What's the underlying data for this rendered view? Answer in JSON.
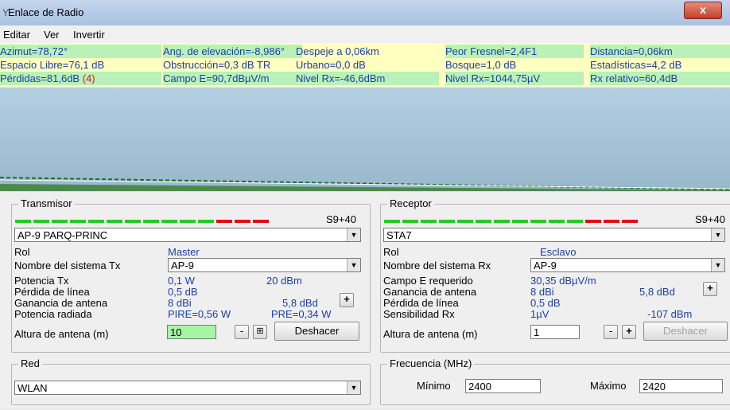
{
  "window": {
    "title": "Enlace de Radio",
    "close_label": "x"
  },
  "menu": [
    "Editar",
    "Ver",
    "Invertir"
  ],
  "info": {
    "row1": [
      "Azimut=78,72°",
      "Ang. de elevación=-8,986°",
      "Despeje a 0,06km",
      "Peor Fresnel=2,4F1",
      "Distancia=0,06km"
    ],
    "row2": [
      "Espacio Libre=76,1 dB",
      "Obstrucción=0,3 dB TR",
      "Urbano=0,0 dB",
      "Bosque=1,0 dB",
      "Estadísticas=4,2 dB"
    ],
    "row3_losses": "Pérdidas=81,6dB",
    "row3_losses_count": "(4)",
    "row3": [
      "Campo E=90,7dBµV/m",
      "Nivel Rx=-46,6dBm",
      "Nivel Rx=1044,75µV",
      "Rx relativo=60,4dB"
    ]
  },
  "transmitter": {
    "legend": "Transmisor",
    "s_meter": "S9+40",
    "site": "AP-9 PARQ-PRINC",
    "role_label": "Rol",
    "role_value": "Master",
    "system_label": "Nombre del sistema Tx",
    "system_value": "AP-9",
    "power_label": "Potencia Tx",
    "power_w": "0,1 W",
    "power_dbm": "20 dBm",
    "line_loss_label": "Pérdida de línea",
    "line_loss": "0,5 dB",
    "gain_label": "Ganancia de antena",
    "gain_dbi": "8 dBi",
    "gain_dbd": "5,8 dBd",
    "radiated_label": "Potencia radiada",
    "pire": "PIRE=0,56 W",
    "pre": "PRE=0,34 W",
    "height_label": "Altura de antena (m)",
    "height_value": "10",
    "undo_label": "Deshacer"
  },
  "receiver": {
    "legend": "Receptor",
    "s_meter": "S9+40",
    "site": "STA7",
    "role_label": "Rol",
    "role_value": "Esclavo",
    "system_label": "Nombre del sistema Rx",
    "system_value": "AP-9",
    "field_label": "Campo E requerido",
    "field_value": "30,35 dBµV/m",
    "gain_label": "Ganancia de antena",
    "gain_dbi": "8 dBi",
    "gain_dbd": "5,8 dBd",
    "line_loss_label": "Pérdida de línea",
    "line_loss": "0,5 dB",
    "sens_label": "Sensibilidad Rx",
    "sens_uv": "1µV",
    "sens_dbm": "-107 dBm",
    "height_label": "Altura de antena (m)",
    "height_value": "1",
    "undo_label": "Deshacer"
  },
  "network": {
    "legend": "Red",
    "value": "WLAN"
  },
  "frequency": {
    "legend": "Frecuencia (MHz)",
    "min_label": "Mínimo",
    "min_value": "2400",
    "max_label": "Máximo",
    "max_value": "2420"
  },
  "colors": {
    "info_bg": "#ffffc0",
    "info_green": "#b9f1b9",
    "value_blue": "#1a3ea8",
    "profile_sky": "#a6c2d6",
    "meter_green": "#22cc22",
    "meter_red": "#e01010",
    "loss_red": "#e01010"
  }
}
